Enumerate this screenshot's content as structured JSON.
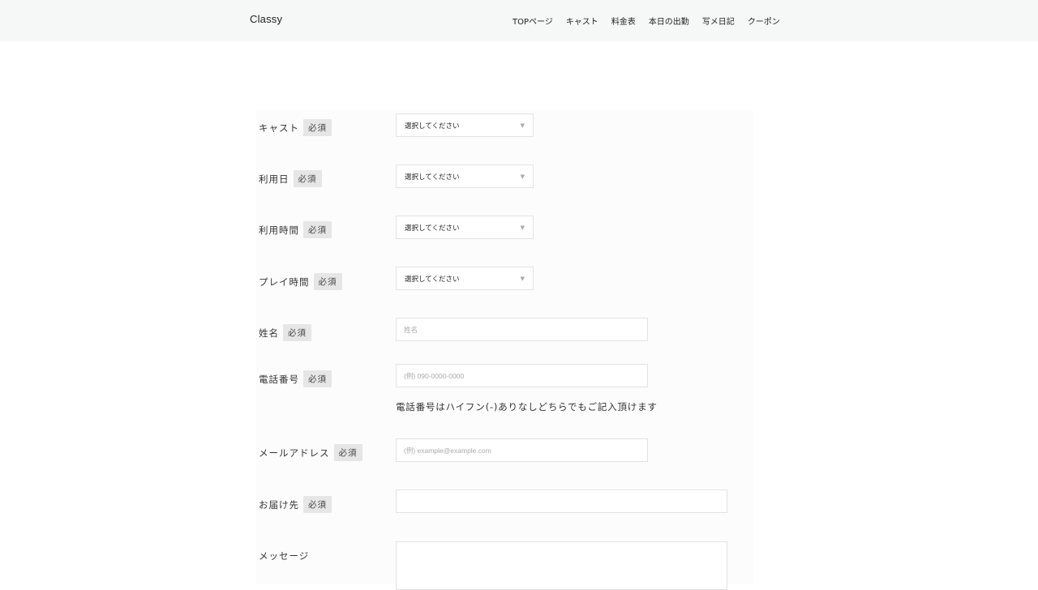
{
  "header": {
    "brand": "Classy",
    "nav": [
      "TOPページ",
      "キャスト",
      "料金表",
      "本日の出勤",
      "写メ日記",
      "クーポン"
    ]
  },
  "form": {
    "required_badge": "必須",
    "select_default": "選択してください",
    "fields": {
      "cast": {
        "label": "キャスト"
      },
      "date": {
        "label": "利用日"
      },
      "time": {
        "label": "利用時間"
      },
      "play_time": {
        "label": "プレイ時間"
      },
      "name": {
        "label": "姓名",
        "placeholder": "姓名"
      },
      "phone": {
        "label": "電話番号",
        "placeholder": "(例) 090-0000-0000",
        "hint": "電話番号はハイフン(-)ありなしどちらでもご記入頂けます"
      },
      "email": {
        "label": "メールアドレス",
        "placeholder": "(例) example@example.com"
      },
      "address": {
        "label": "お届け先",
        "placeholder": ""
      },
      "message": {
        "label": "メッセージ"
      }
    }
  },
  "colors": {
    "header_bg": "#f6f7f7",
    "badge_bg": "#e6e6e6",
    "border": "#e2e2e2"
  }
}
